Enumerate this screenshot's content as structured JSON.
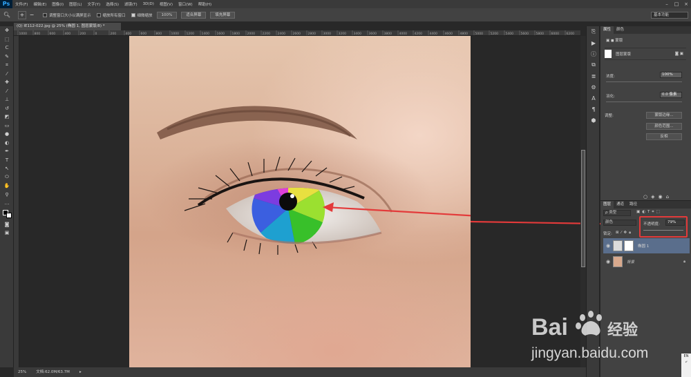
{
  "menu": {
    "logo": "Ps",
    "items": [
      "文件(F)",
      "编辑(E)",
      "图像(I)",
      "图层(L)",
      "文字(Y)",
      "选择(S)",
      "滤镜(T)",
      "3D(D)",
      "视图(V)",
      "窗口(W)",
      "帮助(H)"
    ]
  },
  "options": {
    "resize_label": "调整窗口大小以满屏显示",
    "zoom_all_label": "缩放所有窗口",
    "scrubby_label": "细微缩放",
    "btn_100": "100%",
    "btn_fit": "适合屏幕",
    "btn_fill": "填充屏幕",
    "workspace": "基本功能"
  },
  "document": {
    "tab_title": "(Q) IE112-022.jpg @ 25% (椭圆 1, 图层蒙版/8) *",
    "zoom": "25%",
    "doc_info": "文档:62.0M/63.7M"
  },
  "ruler": {
    "top_ticks": [
      "1000",
      "800",
      "600",
      "400",
      "200",
      "0",
      "200",
      "400",
      "600",
      "800",
      "1000",
      "1200",
      "1400",
      "1600",
      "1800",
      "2000",
      "2200",
      "2400",
      "2600",
      "2800",
      "3000",
      "3200",
      "3400",
      "3600",
      "3800",
      "4000",
      "4200",
      "4400",
      "4600",
      "4800",
      "5000",
      "5200",
      "5400",
      "5600",
      "5800",
      "6000",
      "6200"
    ]
  },
  "properties": {
    "tab_props": "属性",
    "tab_color": "颜色",
    "mask_title": "蒙版",
    "layer_mask_label": "图层蒙版",
    "density_label": "浓度:",
    "density_value": "100%",
    "feather_label": "羽化:",
    "feather_value": "0.0 像素",
    "adjust_label": "调整:",
    "btn_mask_edge": "蒙版边缘...",
    "btn_color_range": "颜色范围...",
    "btn_invert": "反相"
  },
  "layers": {
    "tab_layers": "图层",
    "tab_channels": "通道",
    "tab_paths": "路径",
    "filter_kind": "类型",
    "blend_mode": "颜色",
    "opacity_label": "不透明度:",
    "opacity_value": "79%",
    "lock_label": "锁定:",
    "items": [
      {
        "name": "椭圆 1",
        "selected": true
      },
      {
        "name": "背景",
        "selected": false
      }
    ]
  },
  "watermark": {
    "brand_left": "Bai",
    "brand_right": "经验",
    "url": "jingyan.baidu.com"
  },
  "tray": {
    "lang": "EN"
  },
  "colors": {
    "annotation_red": "#e33a3a",
    "selected_layer": "#5a6e8c"
  }
}
